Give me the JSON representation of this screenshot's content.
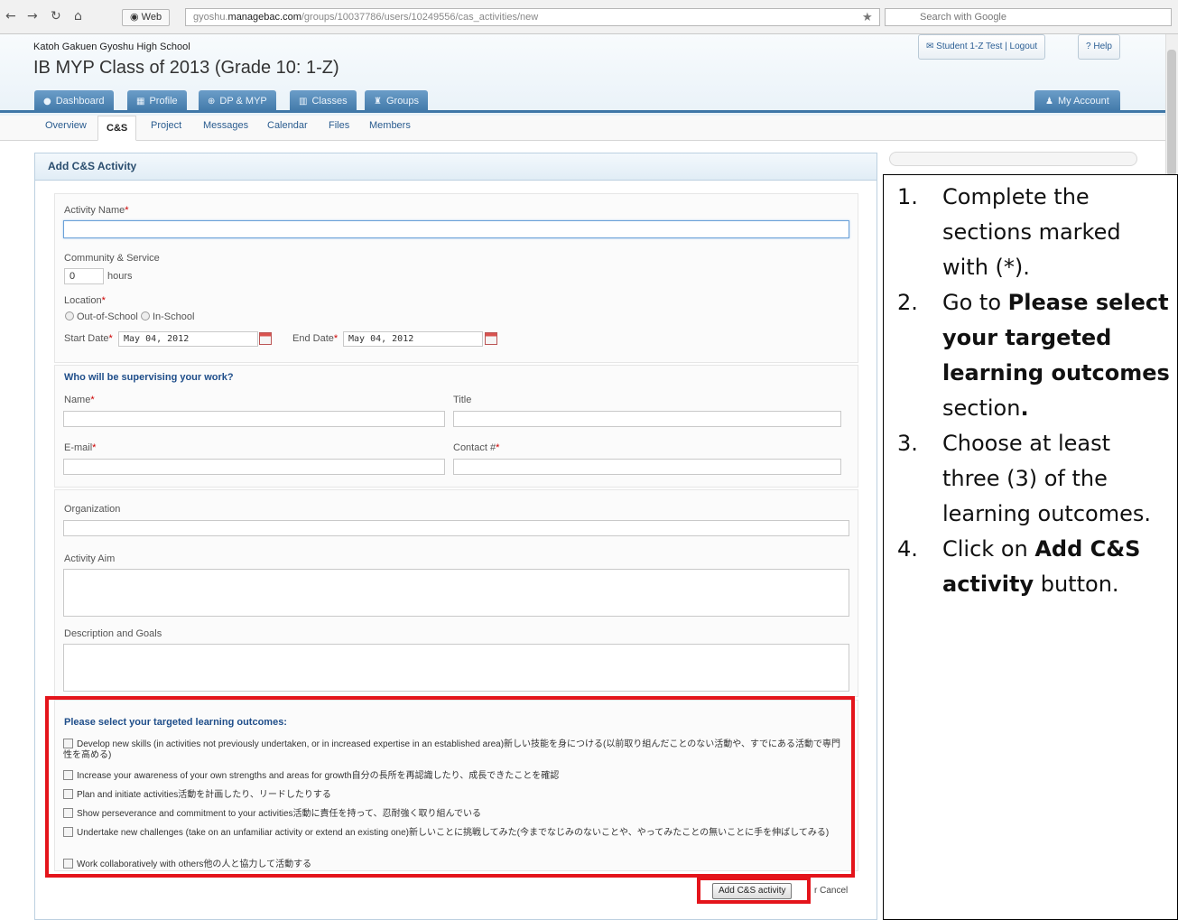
{
  "browser": {
    "web_label": "Web",
    "url_host": "gyoshu.",
    "url_domain": "managebac.com",
    "url_path": "/groups/10037786/users/10249556/cas_activities/new",
    "search_placeholder": "Search with Google"
  },
  "header": {
    "school": "Katoh Gakuen Gyoshu High School",
    "class_title": "IB MYP Class of 2013 (Grade 10: 1-Z)",
    "user_link": "Student 1-Z Test",
    "separator": "|",
    "logout": "Logout",
    "help": "Help",
    "my_account": "My Account"
  },
  "tabs": [
    {
      "label": "Dashboard",
      "icon": "dashboard-icon"
    },
    {
      "label": "Profile",
      "icon": "profile-icon"
    },
    {
      "label": "DP & MYP",
      "icon": "globe-icon"
    },
    {
      "label": "Classes",
      "icon": "classes-icon"
    },
    {
      "label": "Groups",
      "icon": "trophy-icon"
    }
  ],
  "subnav": [
    "Overview",
    "C&S",
    "Project",
    "Messages",
    "Calendar",
    "Files",
    "Members"
  ],
  "form": {
    "title": "Add C&S Activity",
    "activity_name_label": "Activity Name",
    "req_mark": "*",
    "cs_label": "Community & Service",
    "hours_value": "0",
    "hours_unit": "hours",
    "location_label": "Location",
    "location_options": [
      "Out-of-School",
      "In-School"
    ],
    "start_date_label": "Start Date",
    "start_date_value": "May 04, 2012",
    "end_date_label": "End Date",
    "end_date_value": "May 04, 2012",
    "supervisor_heading": "Who will be supervising your work?",
    "name_label": "Name",
    "title_label": "Title",
    "email_label": "E-mail",
    "contact_label": "Contact #",
    "organization_label": "Organization",
    "aim_label": "Activity Aim",
    "description_label": "Description and Goals",
    "outcomes_heading": "Please select your targeted learning outcomes:",
    "outcomes": [
      "Develop new skills (in activities not previously undertaken, or in increased expertise in an established area)新しい技能を身につける(以前取り組んだことのない活動や、すでにある活動で専門性を高める)",
      "Increase your awareness of your own strengths and areas for growth自分の長所を再認識したり、成長できたことを確認",
      "Plan and initiate activities活動を計画したり、リードしたりする",
      "Show perseverance and commitment to your activities活動に責任を持って、忍耐強く取り組んでいる",
      "Undertake new challenges (take on an unfamiliar activity or extend an existing one)新しいことに挑戦してみた(今までなじみのないことや、やってみたことの無いことに手を伸ばしてみる)",
      "Work collaboratively with others他の人と協力して活動する"
    ],
    "submit_label": "Add C&S activity",
    "cancel_label": "r Cancel"
  },
  "instructions": [
    {
      "num": "1.",
      "parts": [
        {
          "t": "Complete the sections marked with (*).",
          "b": false
        }
      ]
    },
    {
      "num": "2.",
      "parts": [
        {
          "t": "Go to ",
          "b": false
        },
        {
          "t": "Please select your targeted learning outcomes",
          "b": true
        },
        {
          "t": " section",
          "b": false
        },
        {
          "t": ".",
          "b": true
        }
      ]
    },
    {
      "num": "3.",
      "parts": [
        {
          "t": "Choose at least three (3) of the learning outcomes.",
          "b": false
        }
      ]
    },
    {
      "num": "4.",
      "parts": [
        {
          "t": "Click on ",
          "b": false
        },
        {
          "t": "Add C&S activity",
          "b": true
        },
        {
          "t": " button.",
          "b": false
        }
      ]
    }
  ],
  "colors": {
    "highlight": "#e4141b",
    "tab_blue": "#3f77a7",
    "link_blue": "#2a5c8f"
  }
}
